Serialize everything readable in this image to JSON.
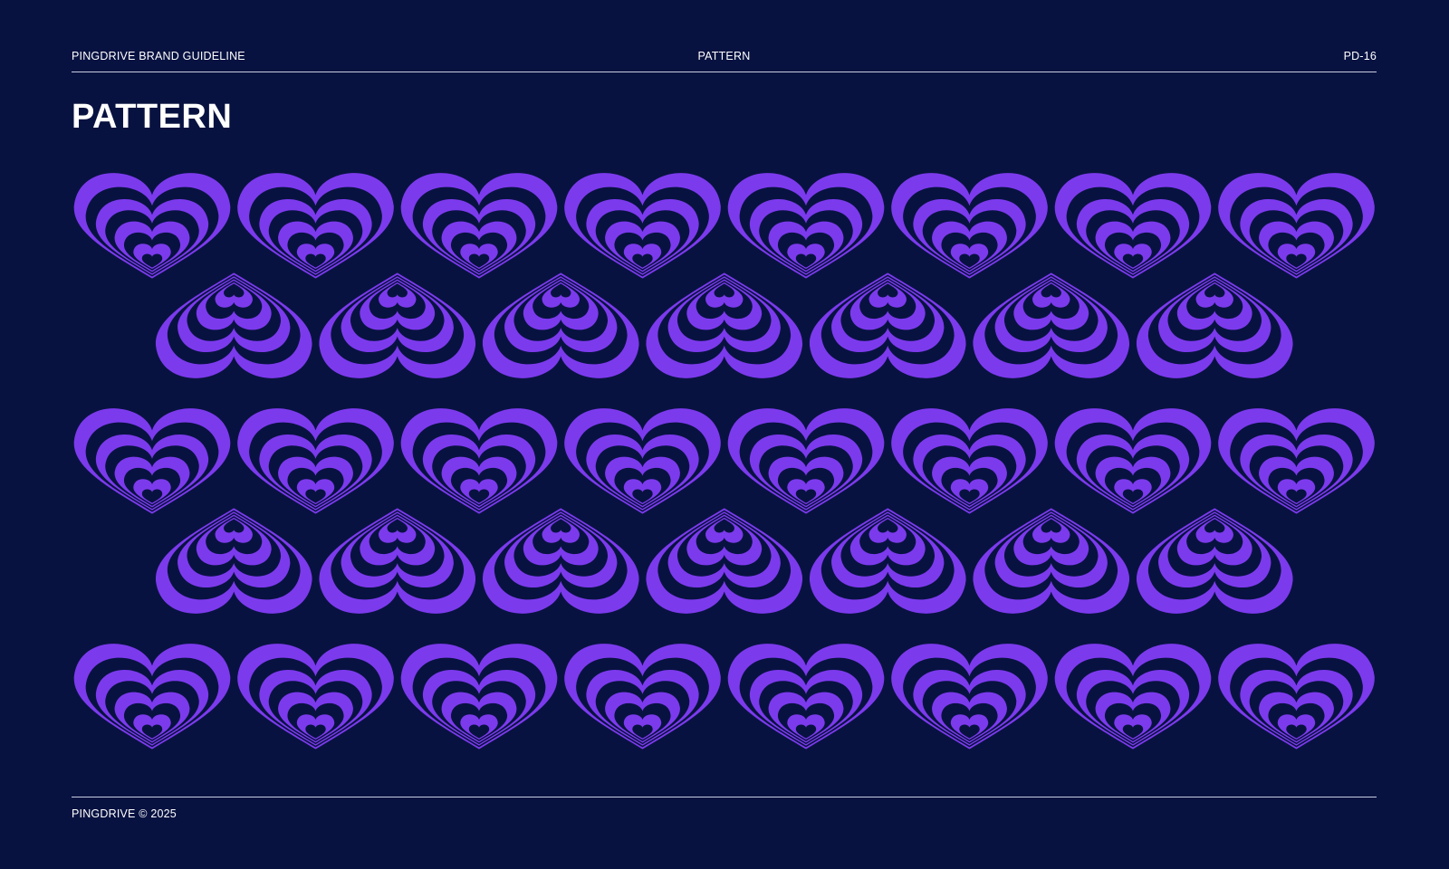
{
  "header": {
    "left": "PINGDRIVE BRAND GUIDELINE",
    "center": "PATTERN",
    "right": "PD-16"
  },
  "title": "PATTERN",
  "footer": {
    "text": "PINGDRIVE © 2025"
  },
  "pattern": {
    "motif": "concentric-heart-stripes",
    "rows": [
      {
        "count": 8,
        "orientation": "upright"
      },
      {
        "count": 7,
        "orientation": "inverted"
      },
      {
        "count": 8,
        "orientation": "upright"
      },
      {
        "count": 7,
        "orientation": "inverted"
      },
      {
        "count": 8,
        "orientation": "upright"
      }
    ]
  },
  "colors": {
    "background": "#081241",
    "motif": "#7c3aed",
    "text": "#ffffff",
    "rule": "#c9cde0"
  }
}
